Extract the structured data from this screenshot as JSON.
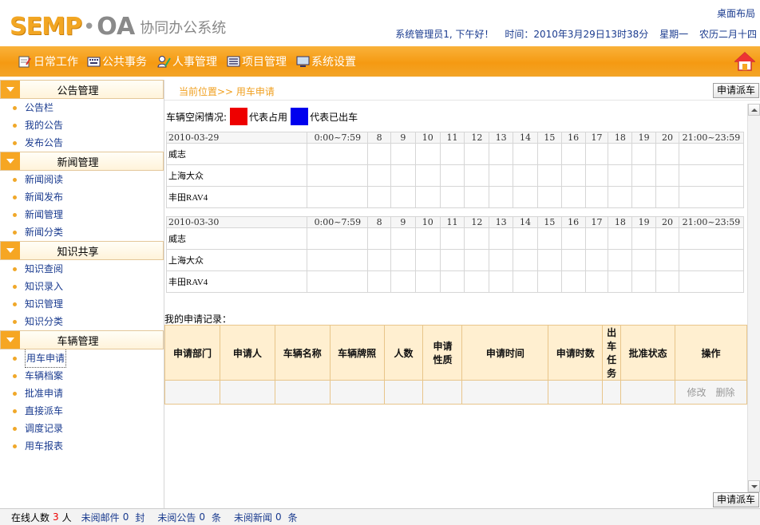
{
  "header": {
    "logo_brand": "SEMP",
    "logo_dot": "•",
    "logo_oa": "OA",
    "logo_sys": "协同办公系统",
    "desk_layout": "桌面布局",
    "greeting": "系统管理员1, 下午好！",
    "time_label": "时间：2010年3月29日13时38分",
    "weekday": "星期一",
    "lunar": "农历二月十四"
  },
  "nav": {
    "items": [
      {
        "label": "日常工作",
        "icon": "notebook-icon"
      },
      {
        "label": "公共事务",
        "icon": "keyboard-icon"
      },
      {
        "label": "人事管理",
        "icon": "person-pen-icon"
      },
      {
        "label": "项目管理",
        "icon": "list-icon"
      },
      {
        "label": "系统设置",
        "icon": "monitor-icon"
      }
    ],
    "home_icon": "home-icon"
  },
  "sidebar": {
    "sections": [
      {
        "title": "公告管理",
        "items": [
          "公告栏",
          "我的公告",
          "发布公告"
        ]
      },
      {
        "title": "新闻管理",
        "items": [
          "新闻阅读",
          "新闻发布",
          "新闻管理",
          "新闻分类"
        ]
      },
      {
        "title": "知识共享",
        "items": [
          "知识查阅",
          "知识录入",
          "知识管理",
          "知识分类"
        ]
      },
      {
        "title": "车辆管理",
        "items": [
          "用车申请",
          "车辆档案",
          "批准申请",
          "直接派车",
          "调度记录",
          "用车报表"
        ]
      }
    ],
    "active_item": "用车申请"
  },
  "main": {
    "breadcrumb": "当前位置>> 用车申请",
    "apply_button": "申请派车",
    "legend_label": "车辆空闲情况:",
    "legend_occupied": "代表占用",
    "legend_dispatched": "代表已出车",
    "occupied_color": "#ee0000",
    "dispatched_color": "#0000ee",
    "time_slots": [
      "0:00~7:59",
      "8",
      "9",
      "10",
      "11",
      "12",
      "13",
      "14",
      "15",
      "16",
      "17",
      "18",
      "19",
      "20",
      "21:00~23:59"
    ],
    "days": [
      {
        "date": "2010-03-29",
        "cars": [
          "威志",
          "上海大众",
          "丰田RAV4"
        ]
      },
      {
        "date": "2010-03-30",
        "cars": [
          "威志",
          "上海大众",
          "丰田RAV4"
        ]
      }
    ],
    "records_title": "我的申请记录：",
    "records_headers": [
      "申请部门",
      "申请人",
      "车辆名称",
      "车辆牌照",
      "人数",
      "申请性质",
      "申请时间",
      "申请时数",
      "出车任务",
      "批准状态",
      "操作"
    ],
    "ops": {
      "edit": "修改",
      "delete": "删除"
    }
  },
  "footer": {
    "online_label": "在线人数",
    "online_count": "3",
    "online_unit": "人",
    "mail_label": "未阅邮件",
    "mail_count": "0",
    "mail_unit": "封",
    "notice_label": "未阅公告",
    "notice_count": "0",
    "notice_unit": "条",
    "news_label": "未阅新闻",
    "news_count": "0",
    "news_unit": "条"
  }
}
